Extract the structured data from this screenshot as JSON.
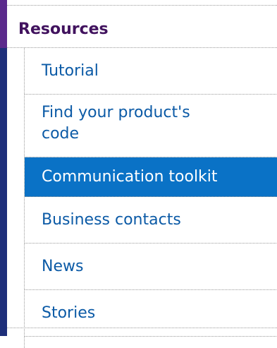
{
  "menu": {
    "header": "Resources",
    "items": [
      {
        "label": "Tutorial"
      },
      {
        "label_line1": "Find your product's",
        "label_line2": "code"
      },
      {
        "label": "Communication toolkit"
      },
      {
        "label": "Business contacts"
      },
      {
        "label": "News"
      },
      {
        "label": "Stories"
      }
    ]
  },
  "colors": {
    "accent_bar": "#5b2a8c",
    "link": "#0b5aa6",
    "active_bg": "#0a72c6",
    "header_text": "#41125e"
  }
}
